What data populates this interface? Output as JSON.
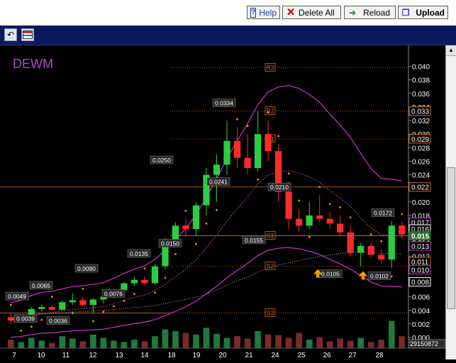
{
  "toolbar": {
    "help_label": "Help",
    "delete_all_label": "Delete All",
    "reload_label": "Reload",
    "upload_label": "Upload"
  },
  "chart_data": {
    "type": "candlestick",
    "title": "DEWM",
    "x_ticks": [
      "7",
      "10",
      "11",
      "12",
      "13",
      "14",
      "18",
      "19",
      "20",
      "21",
      "24",
      "25",
      "26",
      "27",
      "28"
    ],
    "y_ticks": [
      "0.040",
      "0.038",
      "0.036",
      "0.034",
      "0.032",
      "0.030",
      "0.028",
      "0.026",
      "0.024",
      "0.022",
      "0.020",
      "0.018",
      "0.016",
      "0.014",
      "0.012",
      "0.010",
      "0.008",
      "0.006",
      "0.004",
      "0.002",
      "0.000"
    ],
    "ylim": [
      0,
      0.041
    ],
    "pivot_levels": [
      {
        "name": "R3",
        "value": 0.0398
      },
      {
        "name": "R2",
        "value": 0.0334
      },
      {
        "name": "R1",
        "value": 0.0293
      },
      {
        "name": "S1",
        "value": 0.015
      },
      {
        "name": "S2",
        "value": 0.0105
      },
      {
        "name": "S3",
        "value": 0.0036
      }
    ],
    "annotations": [
      {
        "label": "0.0049",
        "x": "7",
        "y": 0.0049
      },
      {
        "label": "0.0039",
        "x": "10",
        "y": 0.0039
      },
      {
        "label": "0.0065",
        "x": "10",
        "y": 0.0065
      },
      {
        "label": "0.0036",
        "x": "11",
        "y": 0.0036
      },
      {
        "label": "0.0090",
        "x": "12",
        "y": 0.009
      },
      {
        "label": "0.0076",
        "x": "13",
        "y": 0.0076
      },
      {
        "label": "0.0135",
        "x": "14",
        "y": 0.0135
      },
      {
        "label": "0.0250",
        "x": "18",
        "y": 0.025
      },
      {
        "label": "0.0150",
        "x": "18",
        "y": 0.015
      },
      {
        "label": "0.0334",
        "x": "20",
        "y": 0.0334
      },
      {
        "label": "0.0241",
        "x": "20",
        "y": 0.0241
      },
      {
        "label": "0.0155",
        "x": "21",
        "y": 0.0155
      },
      {
        "label": "0.0210",
        "x": "24",
        "y": 0.021
      },
      {
        "label": "0.0105",
        "x": "26",
        "y": 0.0105
      },
      {
        "label": "0.0172",
        "x": "28",
        "y": 0.0172
      },
      {
        "label": "0.0102",
        "x": "28",
        "y": 0.0102
      }
    ],
    "right_labels": [
      {
        "label": "0.033",
        "value": 0.0334,
        "color": "#d2691e"
      },
      {
        "label": "0.029",
        "value": 0.0293,
        "color": "#d2691e"
      },
      {
        "label": "0.022",
        "value": 0.0222,
        "color": "#d2691e"
      },
      {
        "label": "0.017",
        "value": 0.017,
        "color": "#cc33cc"
      },
      {
        "label": "0.016",
        "value": 0.016,
        "color": "#ffffff"
      },
      {
        "label": "0.015",
        "value": 0.015,
        "color": "#2f6b2f"
      },
      {
        "label": "0.013",
        "value": 0.0135,
        "color": "#cc33cc"
      },
      {
        "label": "0.011",
        "value": 0.0112,
        "color": "#d2691e"
      },
      {
        "label": "0.010",
        "value": 0.01,
        "color": "#cc33cc"
      },
      {
        "label": "0.008",
        "value": 0.0082,
        "color": "#ffffff"
      }
    ],
    "volume_label": "29150872",
    "candles": [
      {
        "o": 0.003,
        "h": 0.0036,
        "l": 0.002,
        "c": 0.0025
      },
      {
        "o": 0.0025,
        "h": 0.0032,
        "l": 0.0022,
        "c": 0.003
      },
      {
        "o": 0.003,
        "h": 0.0045,
        "l": 0.0028,
        "c": 0.0042
      },
      {
        "o": 0.0042,
        "h": 0.0049,
        "l": 0.0038,
        "c": 0.0045
      },
      {
        "o": 0.0045,
        "h": 0.0048,
        "l": 0.0039,
        "c": 0.0041
      },
      {
        "o": 0.0041,
        "h": 0.0055,
        "l": 0.004,
        "c": 0.0052
      },
      {
        "o": 0.0052,
        "h": 0.0065,
        "l": 0.0048,
        "c": 0.0055
      },
      {
        "o": 0.0055,
        "h": 0.006,
        "l": 0.0045,
        "c": 0.0048
      },
      {
        "o": 0.0048,
        "h": 0.0058,
        "l": 0.0036,
        "c": 0.0056
      },
      {
        "o": 0.0056,
        "h": 0.0064,
        "l": 0.005,
        "c": 0.006
      },
      {
        "o": 0.006,
        "h": 0.0072,
        "l": 0.0058,
        "c": 0.007
      },
      {
        "o": 0.007,
        "h": 0.0082,
        "l": 0.0066,
        "c": 0.008
      },
      {
        "o": 0.008,
        "h": 0.009,
        "l": 0.0076,
        "c": 0.0085
      },
      {
        "o": 0.0085,
        "h": 0.009,
        "l": 0.0076,
        "c": 0.008
      },
      {
        "o": 0.008,
        "h": 0.0108,
        "l": 0.0078,
        "c": 0.0105
      },
      {
        "o": 0.0105,
        "h": 0.0148,
        "l": 0.01,
        "c": 0.0145
      },
      {
        "o": 0.0145,
        "h": 0.017,
        "l": 0.0135,
        "c": 0.0165
      },
      {
        "o": 0.0165,
        "h": 0.0175,
        "l": 0.015,
        "c": 0.016
      },
      {
        "o": 0.016,
        "h": 0.02,
        "l": 0.015,
        "c": 0.0195
      },
      {
        "o": 0.0195,
        "h": 0.025,
        "l": 0.018,
        "c": 0.024
      },
      {
        "o": 0.024,
        "h": 0.027,
        "l": 0.02,
        "c": 0.0255
      },
      {
        "o": 0.0255,
        "h": 0.032,
        "l": 0.024,
        "c": 0.029
      },
      {
        "o": 0.029,
        "h": 0.031,
        "l": 0.025,
        "c": 0.0265
      },
      {
        "o": 0.0265,
        "h": 0.03,
        "l": 0.0241,
        "c": 0.025
      },
      {
        "o": 0.025,
        "h": 0.0334,
        "l": 0.0245,
        "c": 0.03
      },
      {
        "o": 0.03,
        "h": 0.032,
        "l": 0.026,
        "c": 0.0275
      },
      {
        "o": 0.0275,
        "h": 0.0285,
        "l": 0.02,
        "c": 0.0215
      },
      {
        "o": 0.0215,
        "h": 0.023,
        "l": 0.016,
        "c": 0.0175
      },
      {
        "o": 0.0175,
        "h": 0.019,
        "l": 0.0155,
        "c": 0.0165
      },
      {
        "o": 0.0165,
        "h": 0.02,
        "l": 0.016,
        "c": 0.018
      },
      {
        "o": 0.018,
        "h": 0.021,
        "l": 0.017,
        "c": 0.0175
      },
      {
        "o": 0.0175,
        "h": 0.0185,
        "l": 0.016,
        "c": 0.0168
      },
      {
        "o": 0.0168,
        "h": 0.018,
        "l": 0.015,
        "c": 0.0155
      },
      {
        "o": 0.0155,
        "h": 0.0165,
        "l": 0.012,
        "c": 0.0125
      },
      {
        "o": 0.0125,
        "h": 0.014,
        "l": 0.0105,
        "c": 0.0135
      },
      {
        "o": 0.0135,
        "h": 0.014,
        "l": 0.0118,
        "c": 0.0122
      },
      {
        "o": 0.0122,
        "h": 0.013,
        "l": 0.011,
        "c": 0.0115
      },
      {
        "o": 0.0115,
        "h": 0.0172,
        "l": 0.0102,
        "c": 0.0165
      },
      {
        "o": 0.0165,
        "h": 0.017,
        "l": 0.0145,
        "c": 0.0152
      }
    ],
    "volumes": [
      0.25,
      0.18,
      0.3,
      0.22,
      0.15,
      0.35,
      0.28,
      0.2,
      0.4,
      0.3,
      0.22,
      0.18,
      0.25,
      0.2,
      0.35,
      0.55,
      0.5,
      0.45,
      0.4,
      0.6,
      0.42,
      0.3,
      0.35,
      0.28,
      0.5,
      0.4,
      0.38,
      0.3,
      0.45,
      0.25,
      0.32,
      0.2,
      0.28,
      0.22,
      0.3,
      0.18,
      0.25,
      0.8,
      0.35
    ]
  }
}
